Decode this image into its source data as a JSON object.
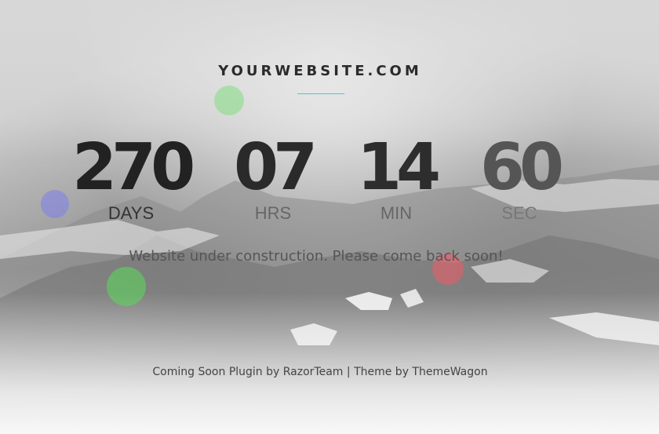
{
  "site": {
    "title": "YOURWEBSITE.COM"
  },
  "countdown": {
    "days": {
      "value": "270",
      "label": "DAYS"
    },
    "hours": {
      "value": "07",
      "label": "HRS"
    },
    "minutes": {
      "value": "14",
      "label": "MIN"
    },
    "seconds": {
      "value": "60",
      "label": "SEC"
    }
  },
  "message": "Website under construction. Please come back soon!",
  "footer": {
    "plugin_link": "Coming Soon Plugin by RazorTeam",
    "separator": "|",
    "theme_link": "Theme by ThemeWagon"
  },
  "colors": {
    "accent_rule": "#4fc3e0",
    "bubble_green": "#82dc82",
    "bubble_blue": "#8282e6",
    "bubble_red": "#f05a64"
  }
}
